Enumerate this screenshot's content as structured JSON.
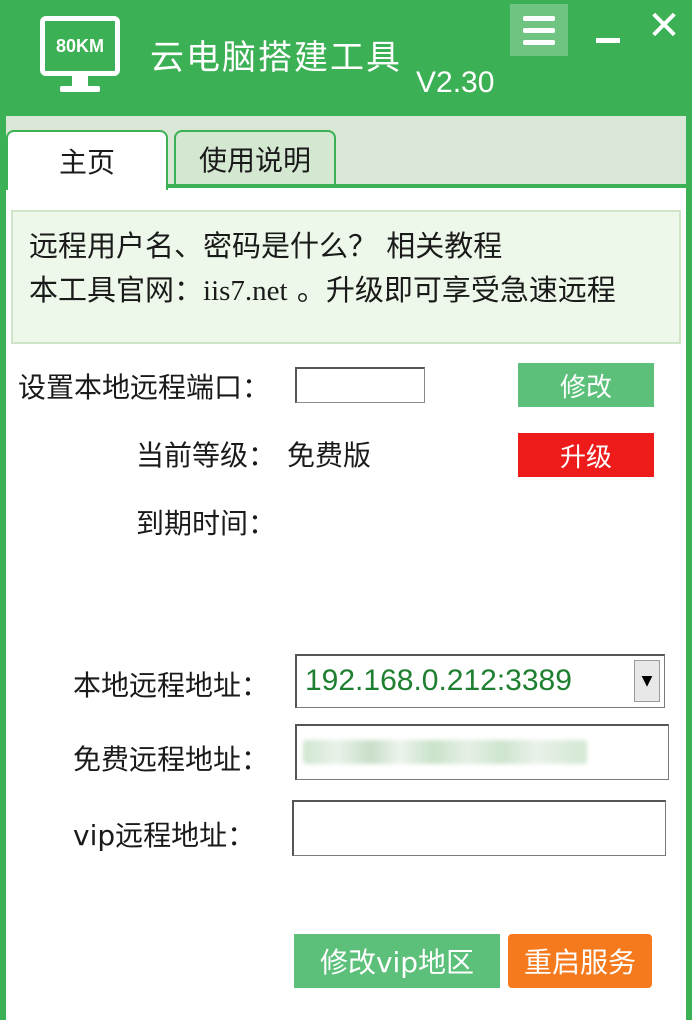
{
  "window": {
    "logo_text": "80KM",
    "title": "云电脑搭建工具",
    "version": "V2.30",
    "icons": {
      "menu": "menu-icon",
      "minimize": "minimize-icon",
      "close": "close-icon"
    },
    "close_glyph": "✕"
  },
  "tabs": [
    {
      "label": "主页",
      "active": true
    },
    {
      "label": "使用说明",
      "active": false
    }
  ],
  "notice": {
    "question": "远程用户名、密码是什么？",
    "tutorial_link": "相关教程",
    "site_prefix": "本工具官网：",
    "site": "iis7.net",
    "site_suffix": "。升级即可享受急速远程"
  },
  "settings": {
    "port_label": "设置本地远程端口：",
    "port_value": "",
    "modify_button": "修改",
    "level_label": "当前等级：",
    "level_value": "免费版",
    "upgrade_button": "升级",
    "expiry_label": "到期时间：",
    "expiry_value": ""
  },
  "addresses": {
    "local_label": "本地远程地址：",
    "local_value": "192.168.0.212:3389",
    "free_label": "免费远程地址：",
    "free_value_blurred": true,
    "vip_label": "vip远程地址：",
    "vip_value": ""
  },
  "actions": {
    "vip_region_button": "修改vip地区",
    "restart_button": "重启服务"
  },
  "colors": {
    "brand_green": "#3cb054",
    "button_green": "#5cc07a",
    "upgrade_red": "#ee1b1b",
    "restart_orange": "#f47a1d",
    "address_text": "#1d7f2f"
  }
}
